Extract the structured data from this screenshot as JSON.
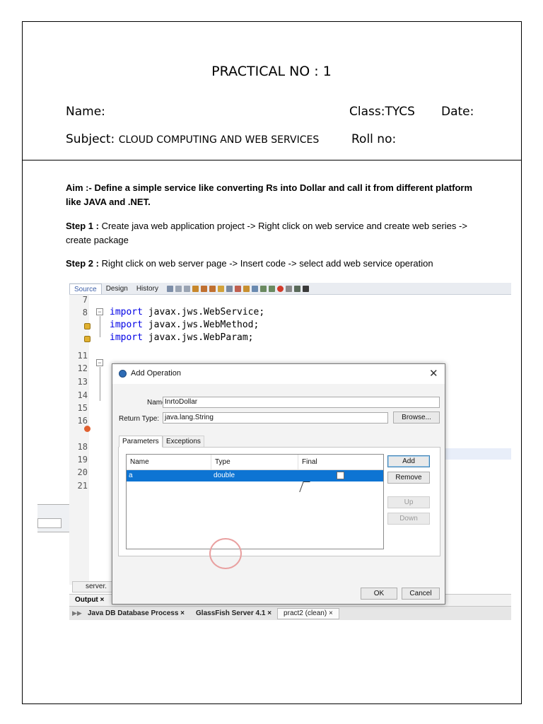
{
  "header": {
    "title": "PRACTICAL NO : 1",
    "name_label": "Name:",
    "class_label": "Class:TYCS",
    "date_label": "Date:",
    "subject_label": "Subject:",
    "subject_value": "CLOUD COMPUTING AND WEB SERVICES",
    "roll_label": "Roll no:"
  },
  "body": {
    "aim": "Aim :-  Define a simple service like converting Rs into Dollar and call it from different platform like JAVA and .NET.",
    "step1_label": "Step 1 :",
    "step1_text": " Create java web application project -> Right click on web service and create web series -> create package",
    "step2_label": "Step 2 :",
    "step2_text": " Right click on web server page -> Insert code -> select add web service operation"
  },
  "ide": {
    "tabs": [
      "Source",
      "Design",
      "History"
    ],
    "line_numbers": [
      "7",
      "8",
      "",
      "",
      "11",
      "12",
      "13",
      "14",
      "15",
      "16",
      "",
      "18",
      "19",
      "20",
      "21"
    ],
    "code_lines": [
      {
        "kw": "import",
        "rest": " javax.jws.WebService;"
      },
      {
        "kw": "import",
        "rest": " javax.jws.WebMethod;"
      },
      {
        "kw": "import",
        "rest": " javax.jws.WebParam;"
      }
    ],
    "fold_12": "/**",
    "server_tab": "server.",
    "output_label": "Output ×",
    "process_tabs": [
      "Java DB Database Process ×",
      "GlassFish Server 4.1 ×",
      "pract2 (clean) ×"
    ]
  },
  "dialog": {
    "title": "Add Operation",
    "close": "✕",
    "name_label": "Name:",
    "name_value": "InrtoDollar",
    "return_type_label": "Return Type:",
    "return_type_value": "java.lang.String",
    "browse_label": "Browse...",
    "tabs": [
      "Parameters",
      "Exceptions"
    ],
    "columns": [
      "Name",
      "Type",
      "Final"
    ],
    "rows": [
      {
        "name": "a",
        "type": "double",
        "final": false
      }
    ],
    "add_label": "Add",
    "remove_label": "Remove",
    "up_label": "Up",
    "down_label": "Down",
    "ok_label": "OK",
    "cancel_label": "Cancel"
  },
  "colors": {
    "selection": "#0d74d3",
    "keyword": "#0000e6"
  }
}
